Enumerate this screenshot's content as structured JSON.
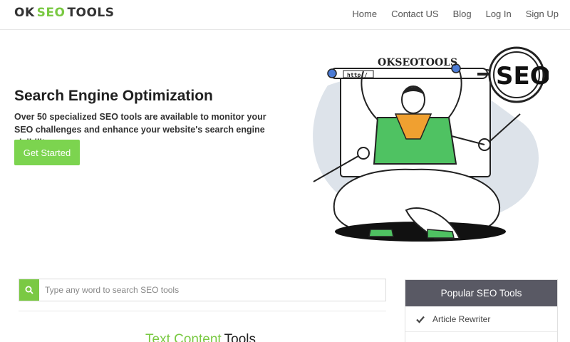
{
  "brand": {
    "logo_ok": "OK",
    "logo_seo": "SEO",
    "logo_tools": "TOOLS"
  },
  "nav": {
    "items": [
      {
        "label": "Home"
      },
      {
        "label": "Contact US"
      },
      {
        "label": "Blog"
      },
      {
        "label": "Log In"
      },
      {
        "label": "Sign Up"
      }
    ]
  },
  "hero": {
    "title": "Search Engine Optimization",
    "description": "Over 50 specialized SEO tools are available to monitor your SEO challenges and enhance your website's search engine visibility.",
    "cta_label": "Get Started",
    "illustration": {
      "bar_label": "OKSEOTOOLS",
      "url_text": "http:/",
      "magnifier_text": "SEO"
    }
  },
  "search": {
    "placeholder": "Type any word to search SEO tools",
    "icon": "search-icon"
  },
  "section": {
    "title_green": "Text Content",
    "title_dark": "Tools"
  },
  "popular": {
    "title": "Popular SEO Tools",
    "items": [
      {
        "label": "Article Rewriter",
        "icon": "check-icon"
      }
    ]
  },
  "colors": {
    "accent": "#7ac943",
    "panel_header": "#595964"
  }
}
